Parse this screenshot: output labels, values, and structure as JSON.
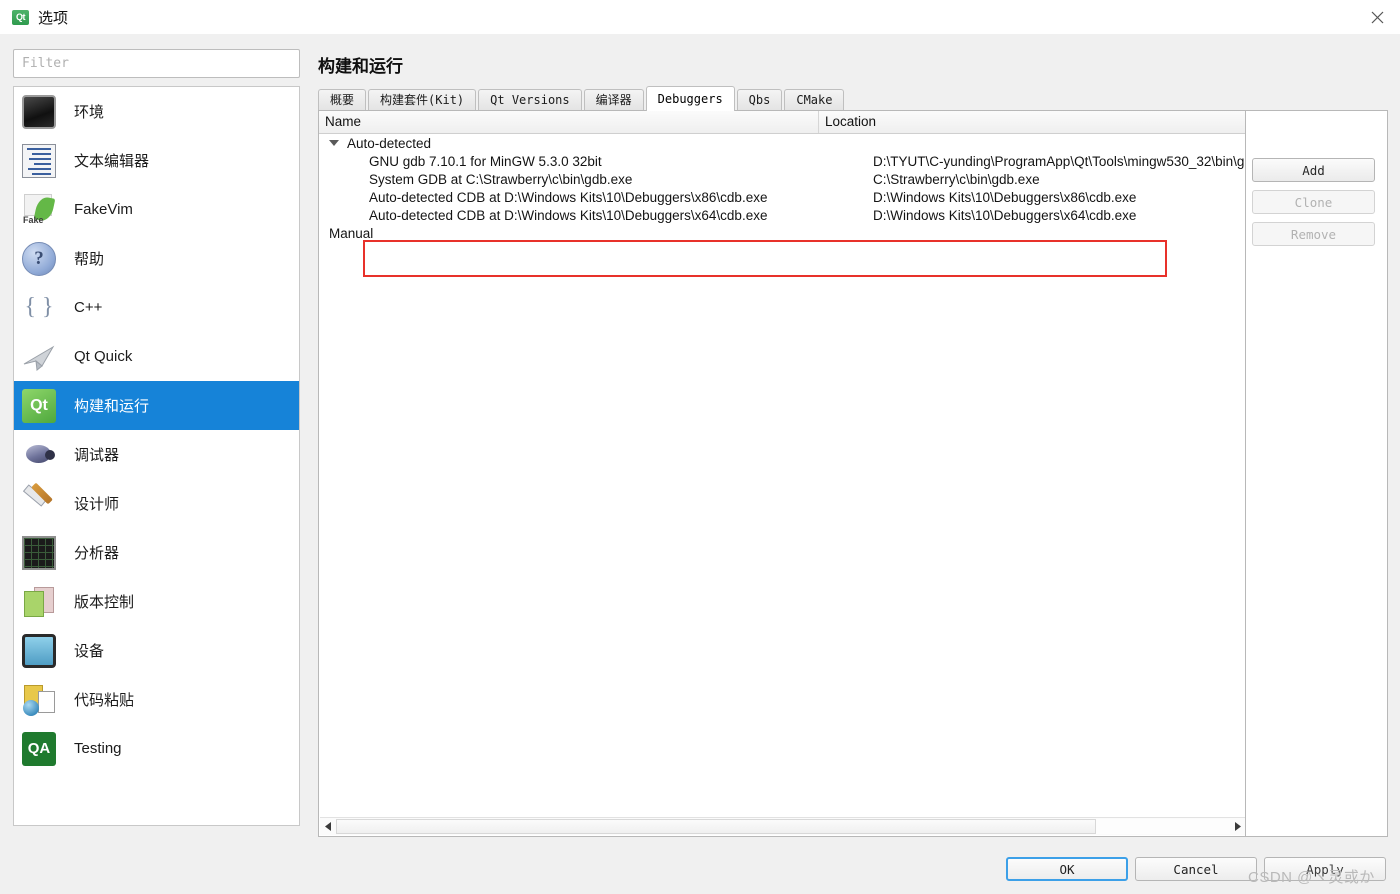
{
  "window": {
    "title": "选项",
    "icon": "qt-logo-icon",
    "close_label": "✕"
  },
  "sidebar": {
    "filter": {
      "placeholder": "Filter",
      "value": ""
    },
    "items": [
      {
        "label": "环境",
        "icon": "monitor-icon",
        "selected": false
      },
      {
        "label": "文本编辑器",
        "icon": "text-editor-icon",
        "selected": false
      },
      {
        "label": "FakeVim",
        "icon": "fakevim-icon",
        "selected": false
      },
      {
        "label": "帮助",
        "icon": "help-icon",
        "selected": false
      },
      {
        "label": "C++",
        "icon": "braces-icon",
        "selected": false
      },
      {
        "label": "Qt Quick",
        "icon": "qtquick-icon",
        "selected": false
      },
      {
        "label": "构建和运行",
        "icon": "build-run-icon",
        "selected": true
      },
      {
        "label": "调试器",
        "icon": "bug-icon",
        "selected": false
      },
      {
        "label": "设计师",
        "icon": "designer-icon",
        "selected": false
      },
      {
        "label": "分析器",
        "icon": "analyzer-icon",
        "selected": false
      },
      {
        "label": "版本控制",
        "icon": "version-control-icon",
        "selected": false
      },
      {
        "label": "设备",
        "icon": "device-icon",
        "selected": false
      },
      {
        "label": "代码粘贴",
        "icon": "code-paste-icon",
        "selected": false
      },
      {
        "label": "Testing",
        "icon": "qa-icon",
        "selected": false
      }
    ]
  },
  "main": {
    "page_title": "构建和运行",
    "tabs": [
      {
        "label": "概要",
        "active": false
      },
      {
        "label": "构建套件(Kit)",
        "active": false
      },
      {
        "label": "Qt Versions",
        "active": false
      },
      {
        "label": "编译器",
        "active": false
      },
      {
        "label": "Debuggers",
        "active": true
      },
      {
        "label": "Qbs",
        "active": false
      },
      {
        "label": "CMake",
        "active": false
      }
    ],
    "table": {
      "columns": [
        "Name",
        "Location"
      ],
      "groups": [
        {
          "name": "Auto-detected",
          "expanded": true,
          "chevron": "chevron-down-icon",
          "rows": [
            {
              "name": "GNU gdb 7.10.1 for MinGW 5.3.0 32bit",
              "location": "D:\\TYUT\\C-yunding\\ProgramApp\\Qt\\Tools\\mingw530_32\\bin\\g",
              "highlighted": false
            },
            {
              "name": "System GDB at C:\\Strawberry\\c\\bin\\gdb.exe",
              "location": "C:\\Strawberry\\c\\bin\\gdb.exe",
              "highlighted": false
            },
            {
              "name": "Auto-detected CDB at D:\\Windows Kits\\10\\Debuggers\\x86\\cdb.exe",
              "location": "D:\\Windows Kits\\10\\Debuggers\\x86\\cdb.exe",
              "highlighted": true
            },
            {
              "name": "Auto-detected CDB at D:\\Windows Kits\\10\\Debuggers\\x64\\cdb.exe",
              "location": "D:\\Windows Kits\\10\\Debuggers\\x64\\cdb.exe",
              "highlighted": true
            }
          ]
        },
        {
          "name": "Manual",
          "expanded": false,
          "chevron": "",
          "rows": []
        }
      ]
    },
    "side_buttons": [
      {
        "label": "Add",
        "enabled": true
      },
      {
        "label": "Clone",
        "enabled": false
      },
      {
        "label": "Remove",
        "enabled": false
      }
    ]
  },
  "footer": {
    "ok": "OK",
    "cancel": "Cancel",
    "apply": "Apply"
  },
  "overlay": {
    "annotation_color": "#e8312a",
    "watermark": "CSDN @ヽ灵或か"
  },
  "colors": {
    "accent": "#1683d8",
    "annotation": "#e8312a",
    "window_bg": "#f0f0f0",
    "panel_bg": "#ffffff"
  }
}
